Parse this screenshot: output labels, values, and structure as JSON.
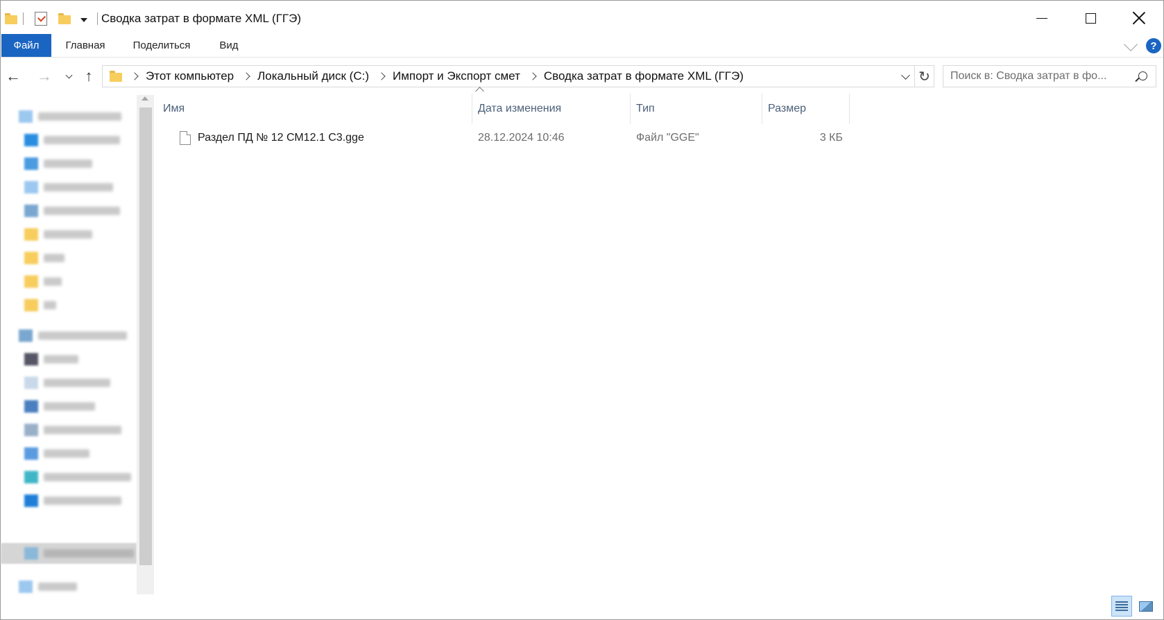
{
  "window": {
    "title": "Сводка затрат в формате XML (ГГЭ)"
  },
  "ribbon": {
    "tabs": [
      "Файл",
      "Главная",
      "Поделиться",
      "Вид"
    ],
    "help_label": "?"
  },
  "address": {
    "breadcrumbs": [
      "Этот компьютер",
      "Локальный диск (C:)",
      "Импорт и Экспорт смет",
      "Сводка затрат в формате XML (ГГЭ)"
    ],
    "refresh_glyph": "↻"
  },
  "search": {
    "placeholder": "Поиск в: Сводка затрат в фо..."
  },
  "nav": {
    "back_glyph": "←",
    "forward_glyph": "→",
    "up_glyph": "↑"
  },
  "file_list": {
    "columns": [
      "Имя",
      "Дата изменения",
      "Тип",
      "Размер"
    ],
    "rows": [
      {
        "name": "Раздел ПД № 12 СМ12.1 С3.gge",
        "modified": "28.12.2024 10:46",
        "type": "Файл \"GGE\"",
        "size": "3 КБ"
      }
    ]
  },
  "colors": {
    "accent": "#1a65c2",
    "header_text": "#4c607a",
    "folder": "#f7cd5d"
  },
  "icons": {
    "folder": "folder-icon",
    "properties": "checkmark-icon",
    "file": "file-icon",
    "search": "search-icon",
    "refresh": "refresh-icon"
  }
}
